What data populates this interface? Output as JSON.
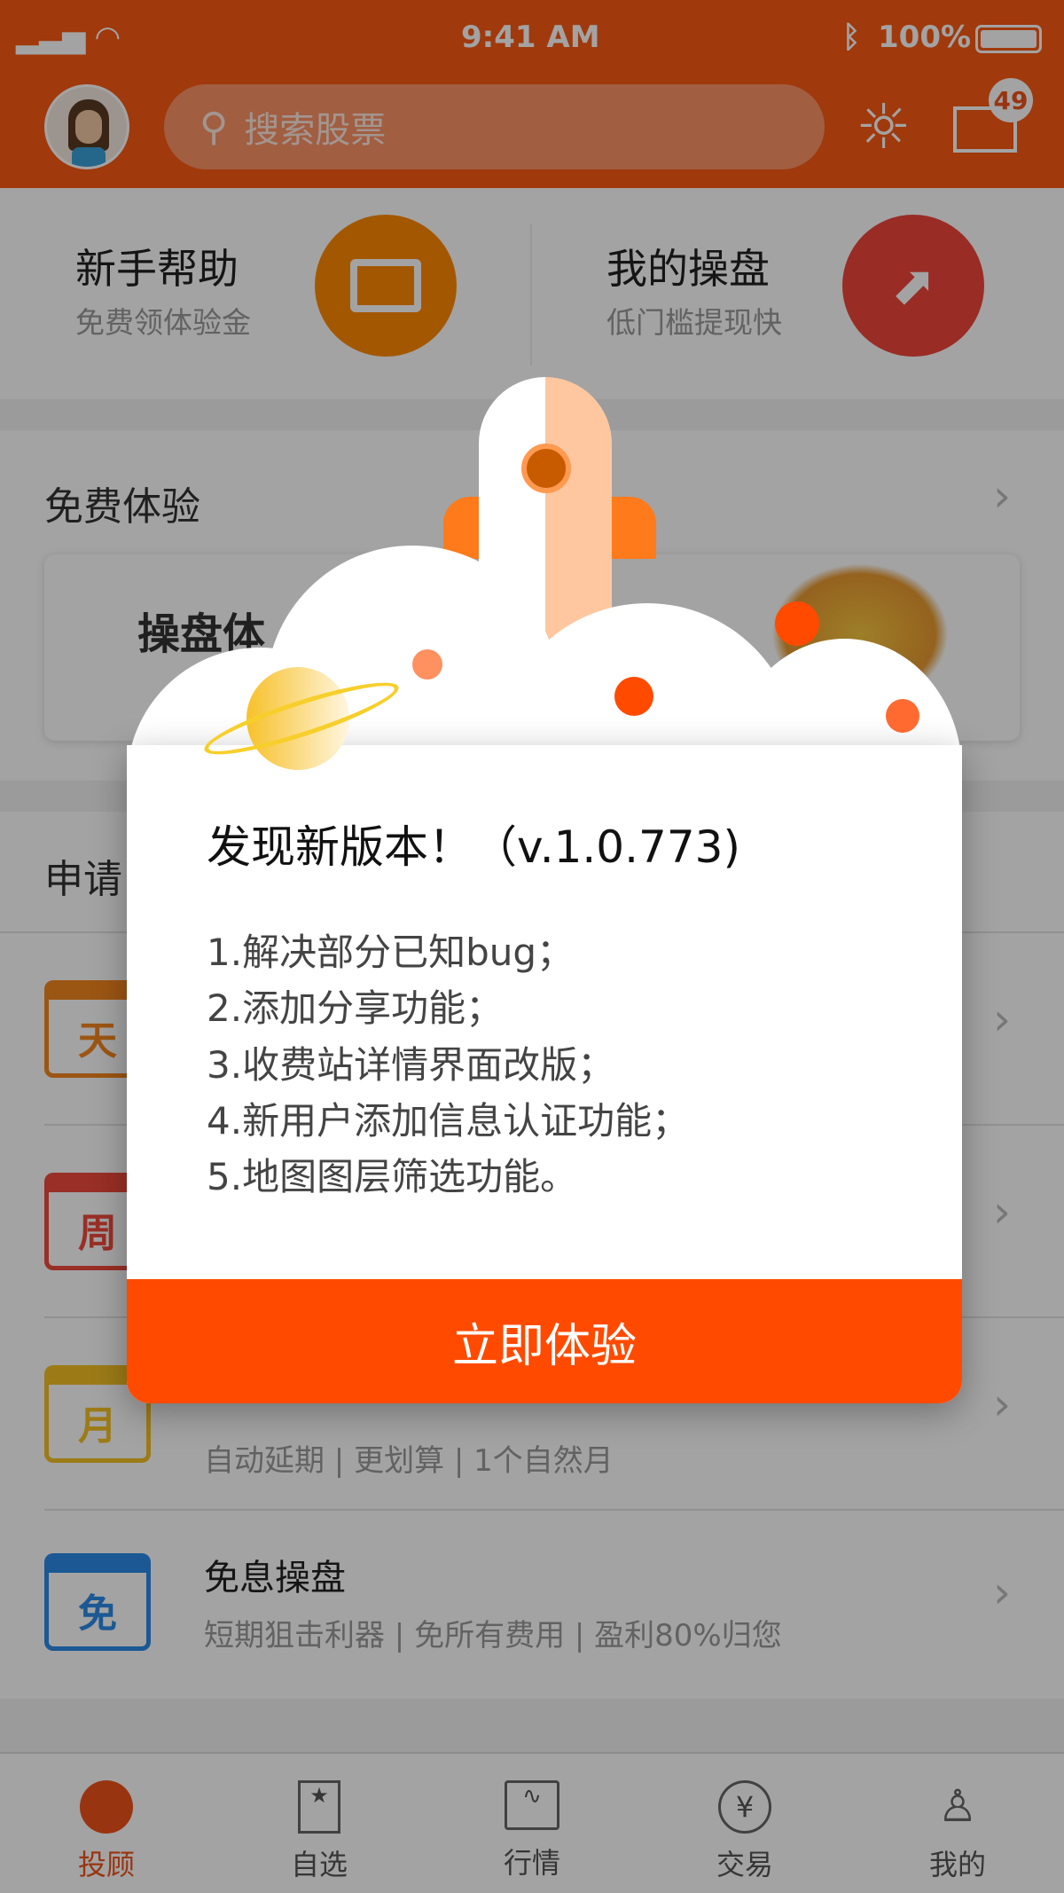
{
  "status_bar": {
    "time": "9:41 AM",
    "battery": "100%"
  },
  "header": {
    "search_placeholder": "搜索股票",
    "mail_badge": "49"
  },
  "quick": [
    {
      "title": "新手帮助",
      "subtitle": "免费领体验金",
      "icon": "book-icon",
      "color": "#ff8a00"
    },
    {
      "title": "我的操盘",
      "subtitle": "低门槛提现快",
      "icon": "monitor-chart-icon",
      "color": "#f0463a"
    }
  ],
  "free_trial": {
    "title": "免费体验",
    "card_title_partial": "操盘体"
  },
  "apply": {
    "title_partial": "申请",
    "rows": [
      {
        "icon_char": "天",
        "color": "#f5871f"
      },
      {
        "icon_char": "周",
        "color": "#ef4a3c"
      },
      {
        "icon_char": "月",
        "color": "#f5c124",
        "subtitle": "自动延期 | 更划算 | 1个自然月"
      },
      {
        "icon_char": "免",
        "color": "#2b8ae8",
        "title": "免息操盘",
        "subtitle": "短期狙击利器 | 免所有费用 | 盈利80%归您"
      }
    ]
  },
  "tabs": [
    {
      "label": "投顾",
      "icon": "pie-chart-icon",
      "active": true
    },
    {
      "label": "自选",
      "icon": "bookmark-star-icon"
    },
    {
      "label": "行情",
      "icon": "line-chart-icon"
    },
    {
      "label": "交易",
      "icon": "yen-circle-icon"
    },
    {
      "label": "我的",
      "icon": "user-icon"
    }
  ],
  "modal": {
    "title": "发现新版本！（v.1.0.773)",
    "items": [
      "1.解决部分已知bug；",
      "2.添加分享功能；",
      "3.收费站详情界面改版；",
      "4.新用户添加信息认证功能；",
      "5.地图图层筛选功能。"
    ],
    "button": "立即体验",
    "accent": "#ff4a00"
  }
}
